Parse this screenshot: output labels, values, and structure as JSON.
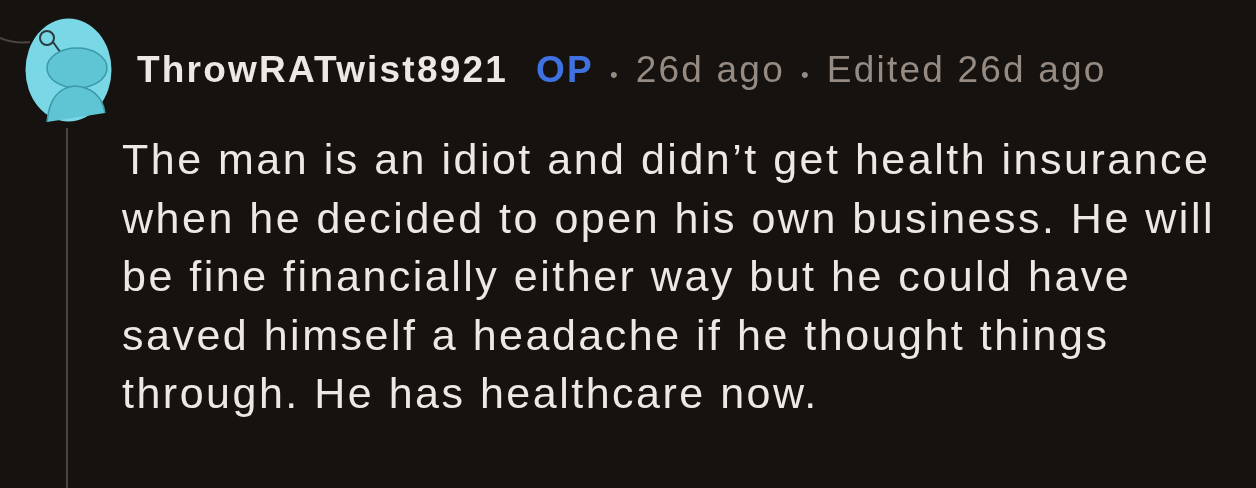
{
  "comment": {
    "author": "ThrowRATwist8921",
    "op_badge": "OP",
    "separator_1": "•",
    "age": "26d ago",
    "separator_2": "•",
    "edited": "Edited 26d ago",
    "body_lines": [
      "The man is an idiot and didn’t get health insurance",
      "when he decided to open his own business. He will",
      "be fine financially either way but he could have",
      "saved himself a headache if he thought things",
      "through. He has healthcare now."
    ]
  }
}
